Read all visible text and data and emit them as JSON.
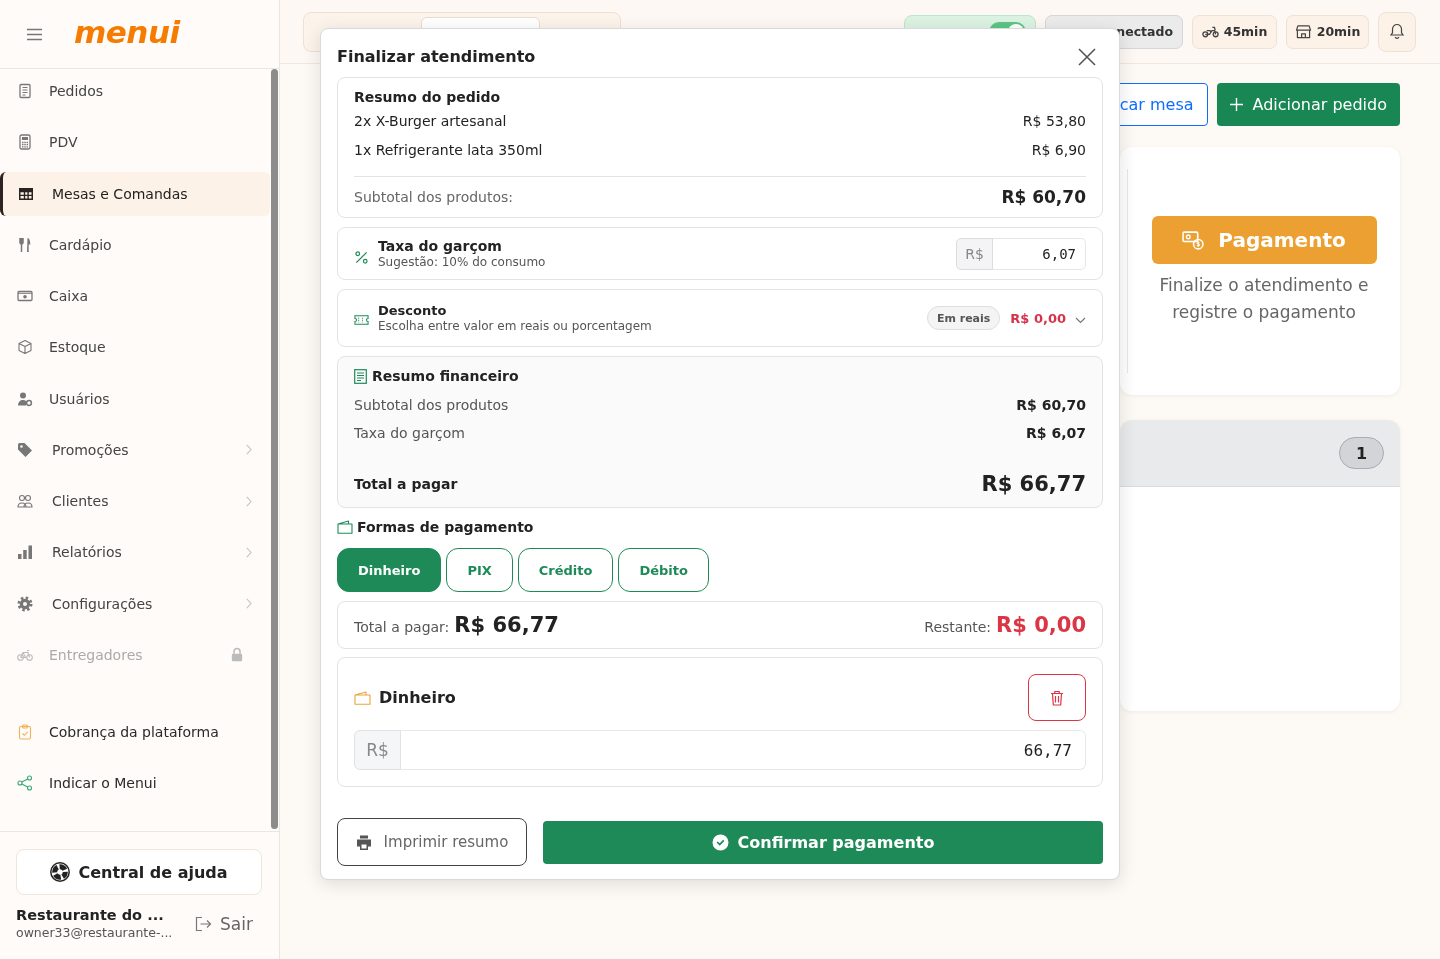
{
  "sidebar": {
    "logo": "menui",
    "nav_items": [
      {
        "label": "Pedidos",
        "selected": false,
        "submenu": false,
        "disabled": false
      },
      {
        "label": "PDV",
        "selected": false,
        "submenu": false,
        "disabled": false
      },
      {
        "label": "Mesas e Comandas",
        "selected": true,
        "submenu": false,
        "disabled": false
      },
      {
        "label": "Cardápio",
        "selected": false,
        "submenu": false,
        "disabled": false
      },
      {
        "label": "Caixa",
        "selected": false,
        "submenu": false,
        "disabled": false
      },
      {
        "label": "Estoque",
        "selected": false,
        "submenu": false,
        "disabled": false
      },
      {
        "label": "Usuários",
        "selected": false,
        "submenu": false,
        "disabled": false
      },
      {
        "label": "Promoções",
        "selected": false,
        "submenu": true,
        "disabled": false
      },
      {
        "label": "Clientes",
        "selected": false,
        "submenu": true,
        "disabled": false
      },
      {
        "label": "Relatórios",
        "selected": false,
        "submenu": true,
        "disabled": false
      },
      {
        "label": "Configurações",
        "selected": false,
        "submenu": true,
        "disabled": false
      },
      {
        "label": "Entregadores",
        "selected": false,
        "submenu": false,
        "disabled": true
      }
    ],
    "footer_links": [
      {
        "label": "Cobrança da plataforma"
      },
      {
        "label": "Indicar o Menui"
      }
    ],
    "help_button": "Central de ajuda",
    "account": {
      "name": "Restaurante do ...",
      "email": "owner33@restaurante-...",
      "logout": "Sair"
    }
  },
  "topbar": {
    "toggle_on": true,
    "connection_status": "nectado",
    "delivery_time": "45min",
    "pickup_time": "20min"
  },
  "actions": [
    {
      "label": "car mesa",
      "kind": "outline"
    },
    {
      "label": "Adicionar pedido",
      "kind": "primary"
    }
  ],
  "payment_card": {
    "button": "Pagamento",
    "description": "Finalize o atendimento e registre o pagamento"
  },
  "table_card": {
    "badge": "1"
  },
  "modal": {
    "title": "Finalizar atendimento",
    "order_summary": {
      "title": "Resumo do pedido",
      "items": [
        {
          "name": "2x X-Burger artesanal",
          "price": "R$ 53,80"
        },
        {
          "name": "1x Refrigerante lata 350ml",
          "price": "R$ 6,90"
        }
      ],
      "subtotal_label": "Subtotal dos produtos:",
      "subtotal": "R$ 60,70"
    },
    "service_fee": {
      "title": "Taxa do garçom",
      "hint": "Sugestão: 10% do consumo",
      "prefix": "R$",
      "value": "6,07"
    },
    "discount": {
      "title": "Desconto",
      "hint": "Escolha entre valor em reais ou porcentagem",
      "mode": "Em reais",
      "value": "R$ 0,00",
      "expanded": false
    },
    "financial_summary": {
      "title": "Resumo financeiro",
      "rows": [
        {
          "label": "Subtotal dos produtos",
          "value": "R$ 60,70"
        },
        {
          "label": "Taxa do garçom",
          "value": "R$ 6,07"
        }
      ],
      "total_label": "Total a pagar",
      "total": "R$ 66,77"
    },
    "payment_methods": {
      "title": "Formas de pagamento",
      "options": [
        {
          "label": "Dinheiro",
          "selected": true
        },
        {
          "label": "PIX",
          "selected": false
        },
        {
          "label": "Crédito",
          "selected": false
        },
        {
          "label": "Débito",
          "selected": false
        }
      ]
    },
    "totals": {
      "total_label": "Total a pagar:",
      "total": "R$ 66,77",
      "remaining_label": "Restante:",
      "remaining": "R$ 0,00"
    },
    "payments": [
      {
        "method": "Dinheiro",
        "prefix": "R$",
        "amount": "66,77"
      }
    ],
    "buttons": [
      {
        "label": "Imprimir resumo",
        "kind": "secondary"
      },
      {
        "label": "Confirmar pagamento",
        "kind": "primary"
      }
    ]
  }
}
